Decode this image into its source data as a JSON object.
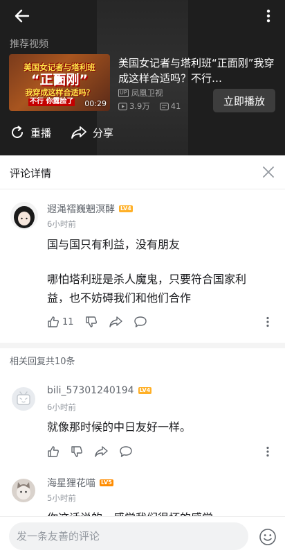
{
  "video": {
    "section_label": "推荐视频",
    "thumbnail": {
      "line1": "美国女记者与塔利班",
      "line2": "“正面刚”",
      "line3": "我穿成这样合适吗？",
      "line4": "不行 你露脸了",
      "duration": "00:29"
    },
    "title": "美国女记者与塔利班“正面刚”我穿成这样合适吗？不行…",
    "uploader_badge": "UP",
    "uploader": "凤凰卫视",
    "views": "3.9万",
    "danmaku": "41",
    "play_now": "立即播放",
    "replay": "重播",
    "share": "分享"
  },
  "detail": {
    "title": "评论详情"
  },
  "main_comment": {
    "user": "遐渑褶巍魍溟酵",
    "level": "LV4",
    "time": "6小时前",
    "text_line1": "国与国只有利益，没有朋友",
    "text_line2": "哪怕塔利班是杀人魔鬼，只要符合国家利",
    "text_line3": "益，也不妨碍我们和他们合作",
    "likes": "11"
  },
  "replies_count": "相关回复共10条",
  "replies": [
    {
      "user": "bili_57301240194",
      "level": "LV4",
      "time": "6小时前",
      "text": "就像那时候的中日友好一样。"
    },
    {
      "user": "海星狸花喵",
      "level": "LV5",
      "time": "5小时前",
      "text": "你这话说的，感觉我们很坏的感觉"
    }
  ],
  "input": {
    "placeholder": "发一条友善的评论"
  },
  "colors": {
    "video_bg": "#1e1e1e",
    "level4": "#ffb027",
    "level5": "#ff8c00",
    "text_primary": "#18191c",
    "text_secondary": "#61666d",
    "text_muted": "#9499a0"
  }
}
